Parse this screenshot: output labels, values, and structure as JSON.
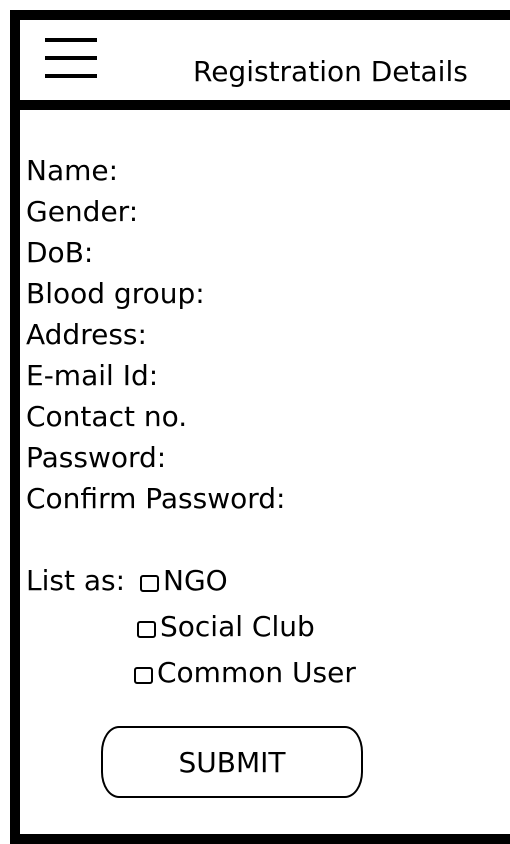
{
  "header": {
    "title": "Registration Details",
    "menu_icon": "hamburger-menu-icon"
  },
  "form": {
    "fields": [
      {
        "label": "Name:"
      },
      {
        "label": "Gender:"
      },
      {
        "label": "DoB:"
      },
      {
        "label": "Blood group:"
      },
      {
        "label": "Address:"
      },
      {
        "label": "E-mail Id:"
      },
      {
        "label": "Contact no."
      },
      {
        "label": "Password:"
      },
      {
        "label": "Confirm Password:"
      }
    ],
    "list_as_label": "List as:",
    "list_options": [
      {
        "label": "NGO",
        "checked": false
      },
      {
        "label": "Social Club",
        "checked": false
      },
      {
        "label": "Common User",
        "checked": false
      }
    ],
    "submit_label": "SUBMIT"
  }
}
